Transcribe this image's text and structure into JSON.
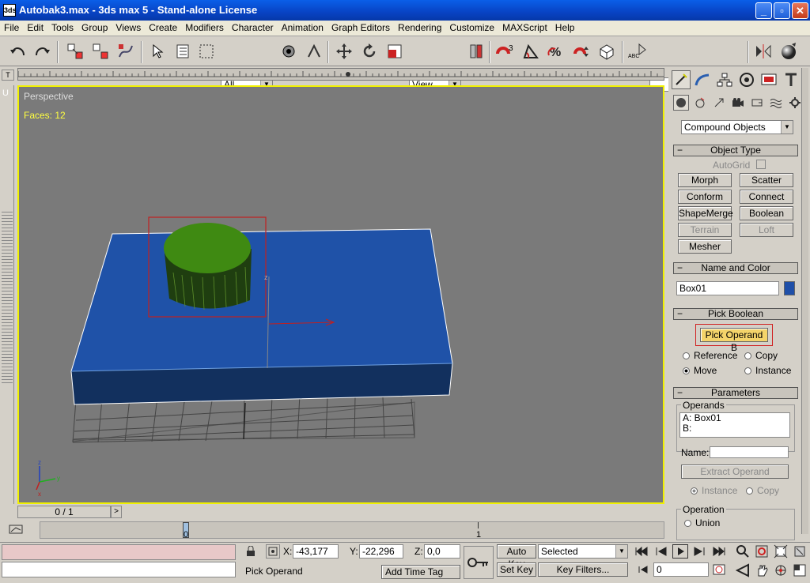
{
  "window": {
    "title": "Autobak3.max - 3ds max 5 - Stand-alone License",
    "icon_text": "3ds"
  },
  "menu": [
    "File",
    "Edit",
    "Tools",
    "Group",
    "Views",
    "Create",
    "Modifiers",
    "Character",
    "Animation",
    "Graph Editors",
    "Rendering",
    "Customize",
    "MAXScript",
    "Help"
  ],
  "toolbar": {
    "selection_filter": "All",
    "ref_coord": "View",
    "named_selection": ""
  },
  "viewport": {
    "label": "Perspective",
    "faces": "Faces: 12"
  },
  "panel": {
    "category": "Compound Objects",
    "object_type": {
      "header": "Object Type",
      "autogrid": "AutoGrid",
      "buttons": [
        "Morph",
        "Scatter",
        "Conform",
        "Connect",
        "ShapeMerge",
        "Boolean",
        "Terrain",
        "Loft",
        "Mesher"
      ]
    },
    "name_color": {
      "header": "Name and Color",
      "name": "Box01",
      "color": "#1f4fa8"
    },
    "pick_boolean": {
      "header": "Pick Boolean",
      "button": "Pick Operand B",
      "radios": [
        "Reference",
        "Copy",
        "Move",
        "Instance"
      ]
    },
    "parameters": {
      "header": "Parameters",
      "operands_label": "Operands",
      "operand_a": "A: Box01",
      "operand_b": "B:",
      "name_label": "Name:",
      "extract": "Extract Operand",
      "instance": "Instance",
      "copy": "Copy",
      "operation_label": "Operation",
      "union": "Union"
    }
  },
  "timeline": {
    "frame": "0 / 1",
    "tick0": "0",
    "tick1": "1"
  },
  "status": {
    "x_label": "X:",
    "x": "-43,177",
    "y_label": "Y:",
    "y": "-22,296",
    "z_label": "Z:",
    "z": "0,0",
    "prompt": "Pick Operand",
    "add_time_tag": "Add Time Tag",
    "auto_key": "Auto Key",
    "set_key": "Set Key",
    "selected": "Selected",
    "key_filters": "Key Filters...",
    "frame_field": "0"
  }
}
